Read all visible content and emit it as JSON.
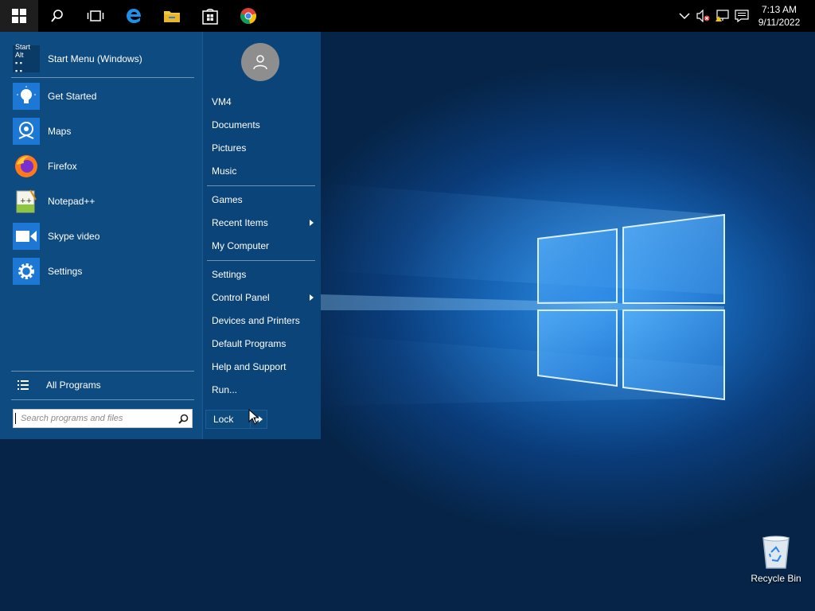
{
  "taskbar": {
    "buttons": [
      {
        "icon": "windows-logo-icon"
      },
      {
        "icon": "search-icon"
      },
      {
        "icon": "task-view-icon"
      },
      {
        "icon": "edge-icon"
      },
      {
        "icon": "file-explorer-icon"
      },
      {
        "icon": "store-icon"
      },
      {
        "icon": "chrome-icon"
      }
    ],
    "tray": {
      "icons": [
        "chevron-up-icon",
        "volume-muted-icon",
        "network-warning-icon",
        "action-center-icon"
      ],
      "time": "7:13 AM",
      "date": "9/11/2022"
    }
  },
  "start_menu": {
    "header": {
      "label": "Start Menu (Windows)",
      "tile_lines": [
        "Start",
        "Alt",
        "▪ ▪",
        "▪ ▪"
      ]
    },
    "programs": [
      {
        "label": "Get Started",
        "icon": "lightbulb-icon"
      },
      {
        "label": "Maps",
        "icon": "maps-icon"
      },
      {
        "label": "Firefox",
        "icon": "firefox-icon"
      },
      {
        "label": "Notepad++",
        "icon": "notepad-plus-plus-icon"
      },
      {
        "label": "Skype video",
        "icon": "video-camera-icon"
      },
      {
        "label": "Settings",
        "icon": "gear-icon"
      }
    ],
    "all_programs": "All Programs",
    "search_placeholder": "Search programs and files",
    "right": {
      "items": [
        {
          "label": "VM4"
        },
        {
          "label": "Documents"
        },
        {
          "label": "Pictures"
        },
        {
          "label": "Music"
        },
        {
          "label": "Games"
        },
        {
          "label": "Recent Items",
          "submenu": true
        },
        {
          "label": "My Computer"
        },
        {
          "label": "Settings"
        },
        {
          "label": "Control Panel",
          "submenu": true
        },
        {
          "label": "Devices and Printers"
        },
        {
          "label": "Default Programs"
        },
        {
          "label": "Help and Support"
        },
        {
          "label": "Run..."
        }
      ],
      "lock_label": "Lock"
    }
  },
  "desktop": {
    "recycle_bin_label": "Recycle Bin"
  },
  "colors": {
    "menu_bg": "#0d4a7e",
    "taskbar_bg": "#000000",
    "separator": "#6f93b8"
  }
}
